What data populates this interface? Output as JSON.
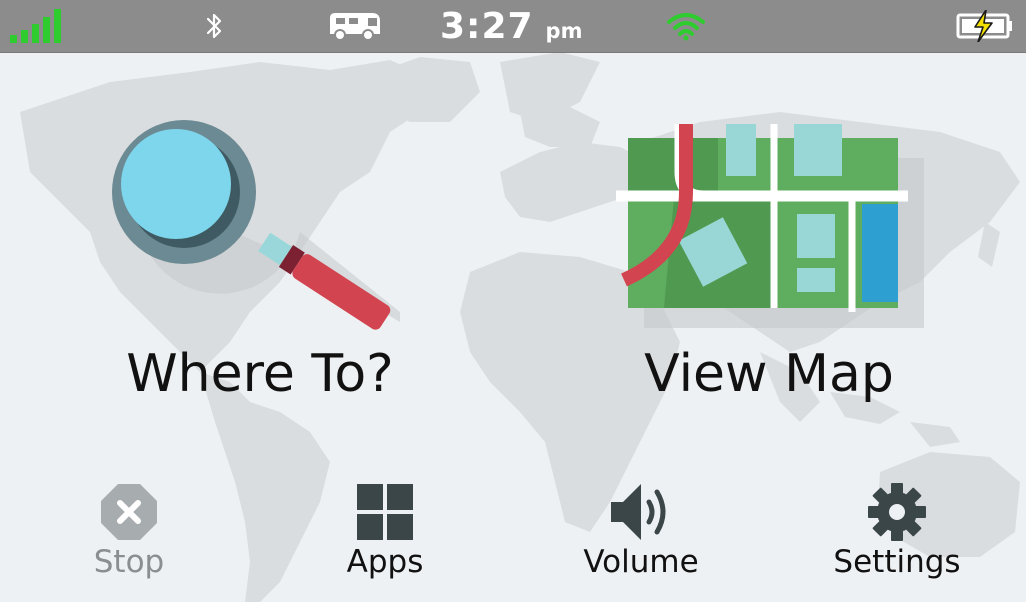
{
  "status_bar": {
    "time": "3:27",
    "ampm": "pm",
    "colors": {
      "bar": "#8c8c8c",
      "signal": "#2ecc2e",
      "wifi": "#2ecc2e",
      "battery_bolt": "#f3e000"
    },
    "icons": [
      "signal-bars-icon",
      "bluetooth-icon",
      "rv-camper-icon",
      "wifi-icon",
      "battery-charging-icon"
    ]
  },
  "main": {
    "where_to": {
      "label": "Where To?",
      "icon": "magnifying-glass-icon"
    },
    "view_map": {
      "label": "View Map",
      "icon": "map-icon"
    }
  },
  "bottom_bar": {
    "stop": {
      "label": "Stop",
      "icon": "stop-x-icon",
      "enabled": false
    },
    "apps": {
      "label": "Apps",
      "icon": "apps-grid-icon"
    },
    "volume": {
      "label": "Volume",
      "icon": "speaker-icon"
    },
    "settings": {
      "label": "Settings",
      "icon": "gear-icon"
    }
  },
  "colors": {
    "background": "#eef1f3",
    "map_land": "#dadddf",
    "text": "#111111",
    "disabled_text": "#8a8e90",
    "icon_dark": "#3a4648"
  }
}
